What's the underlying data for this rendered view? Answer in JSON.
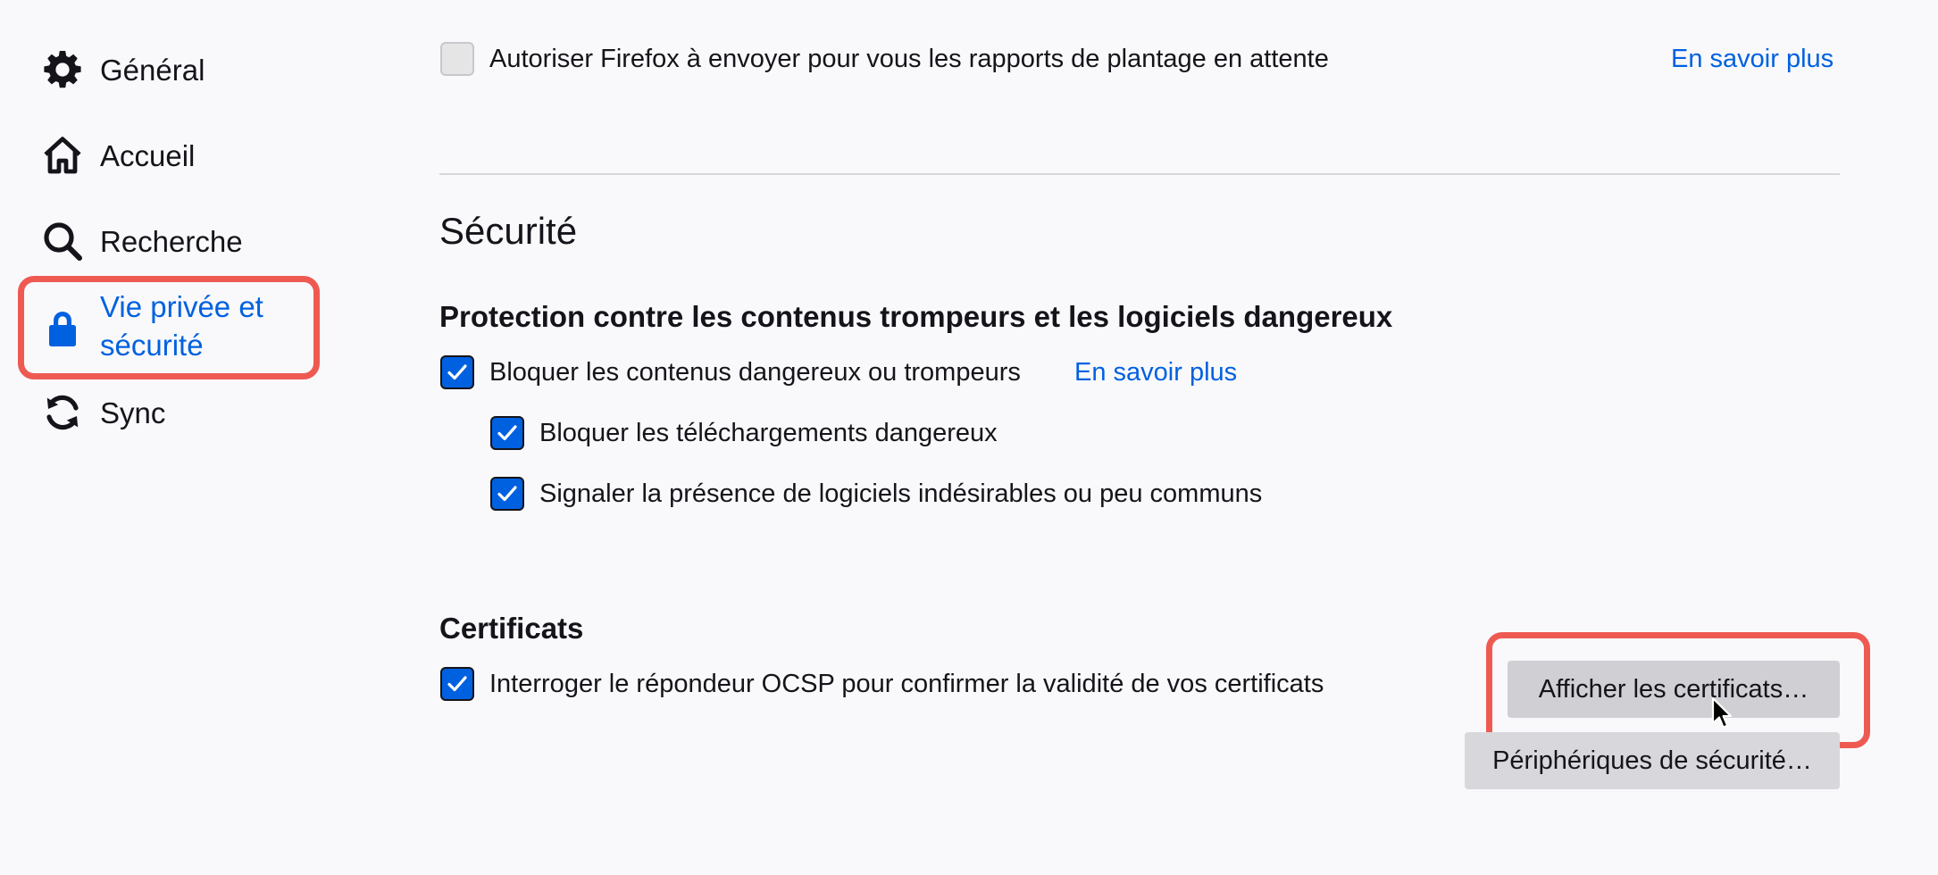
{
  "sidebar": {
    "items": [
      {
        "label": "Général",
        "icon": "gear-icon"
      },
      {
        "label": "Accueil",
        "icon": "home-icon"
      },
      {
        "label": "Recherche",
        "icon": "search-icon"
      },
      {
        "label_line1": "Vie privée et",
        "label_line2": "sécurité",
        "icon": "lock-icon",
        "selected": true
      },
      {
        "label": "Sync",
        "icon": "sync-icon"
      }
    ]
  },
  "main": {
    "crash_reports": {
      "label": "Autoriser Firefox à envoyer pour vous les rapports de plantage en attente",
      "checked": false,
      "learn_more": "En savoir plus"
    },
    "security": {
      "title": "Sécurité",
      "protection": {
        "heading": "Protection contre les contenus trompeurs et les logiciels dangereux",
        "block_dangerous": {
          "label": "Bloquer les contenus dangereux ou trompeurs",
          "checked": true,
          "learn_more": "En savoir plus"
        },
        "block_downloads": {
          "label": "Bloquer les téléchargements dangereux",
          "checked": true
        },
        "warn_unwanted": {
          "label": "Signaler la présence de logiciels indésirables ou peu communs",
          "checked": true
        }
      },
      "certificates": {
        "heading": "Certificats",
        "ocsp": {
          "label": "Interroger le répondeur OCSP pour confirmer la validité de vos certificats",
          "checked": true
        },
        "view_button": "Afficher les certificats…",
        "devices_button": "Périphériques de sécurité…"
      }
    }
  },
  "colors": {
    "accent": "#0061e0",
    "highlight": "#ee5a52",
    "background": "#f9f9fb"
  }
}
